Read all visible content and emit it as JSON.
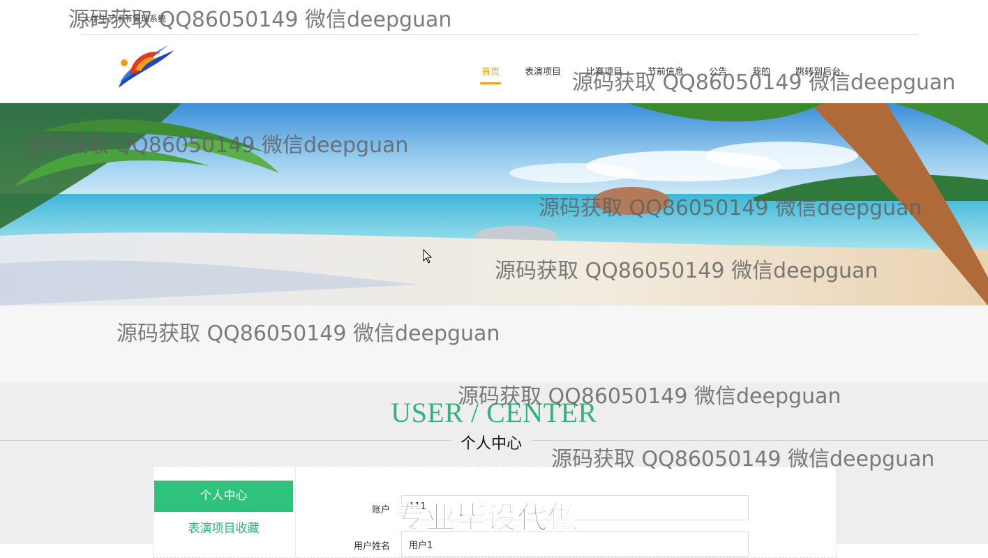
{
  "site_title": "大学生艺术节管理系统",
  "nav": {
    "items": [
      {
        "label": "首页",
        "active": true
      },
      {
        "label": "表演项目",
        "active": false
      },
      {
        "label": "比赛项目",
        "active": false
      },
      {
        "label": "节前信息",
        "active": false
      },
      {
        "label": "公告",
        "active": false
      },
      {
        "label": "我的",
        "active": false
      },
      {
        "label": "跳转到后台",
        "active": false
      }
    ]
  },
  "section": {
    "title_en": "USER / CENTER",
    "title_zh": "个人中心"
  },
  "sidebar": {
    "active_label": "个人中心",
    "link_label": "表演项目收藏"
  },
  "form": {
    "account_label": "账户",
    "account_value": "111",
    "username_label": "用户姓名",
    "username_value": "用户1"
  },
  "watermark_text": "源码获取 QQ86050149 微信deepguan",
  "stamp_text": "专业毕设代做",
  "colors": {
    "accent_green": "#2fc27c",
    "nav_active": "#f0a21a"
  }
}
